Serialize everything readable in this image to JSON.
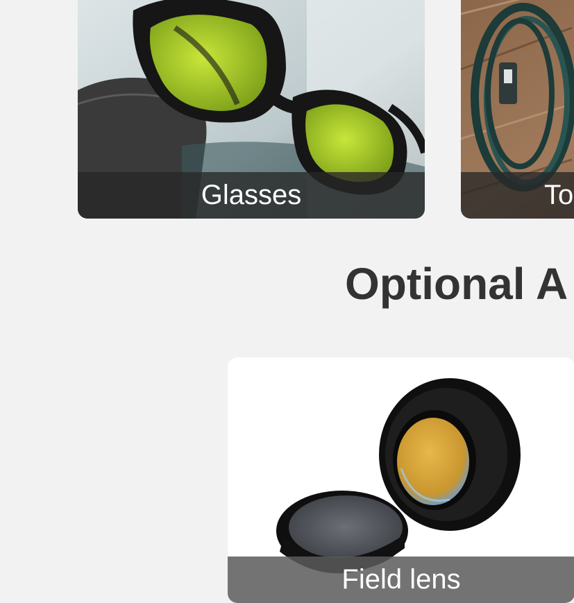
{
  "cards": {
    "glasses": {
      "caption": "Glasses",
      "image_icon": "laser-safety-glasses-image"
    },
    "second": {
      "caption": "To",
      "image_icon": "cable-coil-image"
    },
    "field_lens": {
      "caption": "Field lens",
      "image_icon": "field-lens-image"
    }
  },
  "section": {
    "title": "Optional A"
  }
}
